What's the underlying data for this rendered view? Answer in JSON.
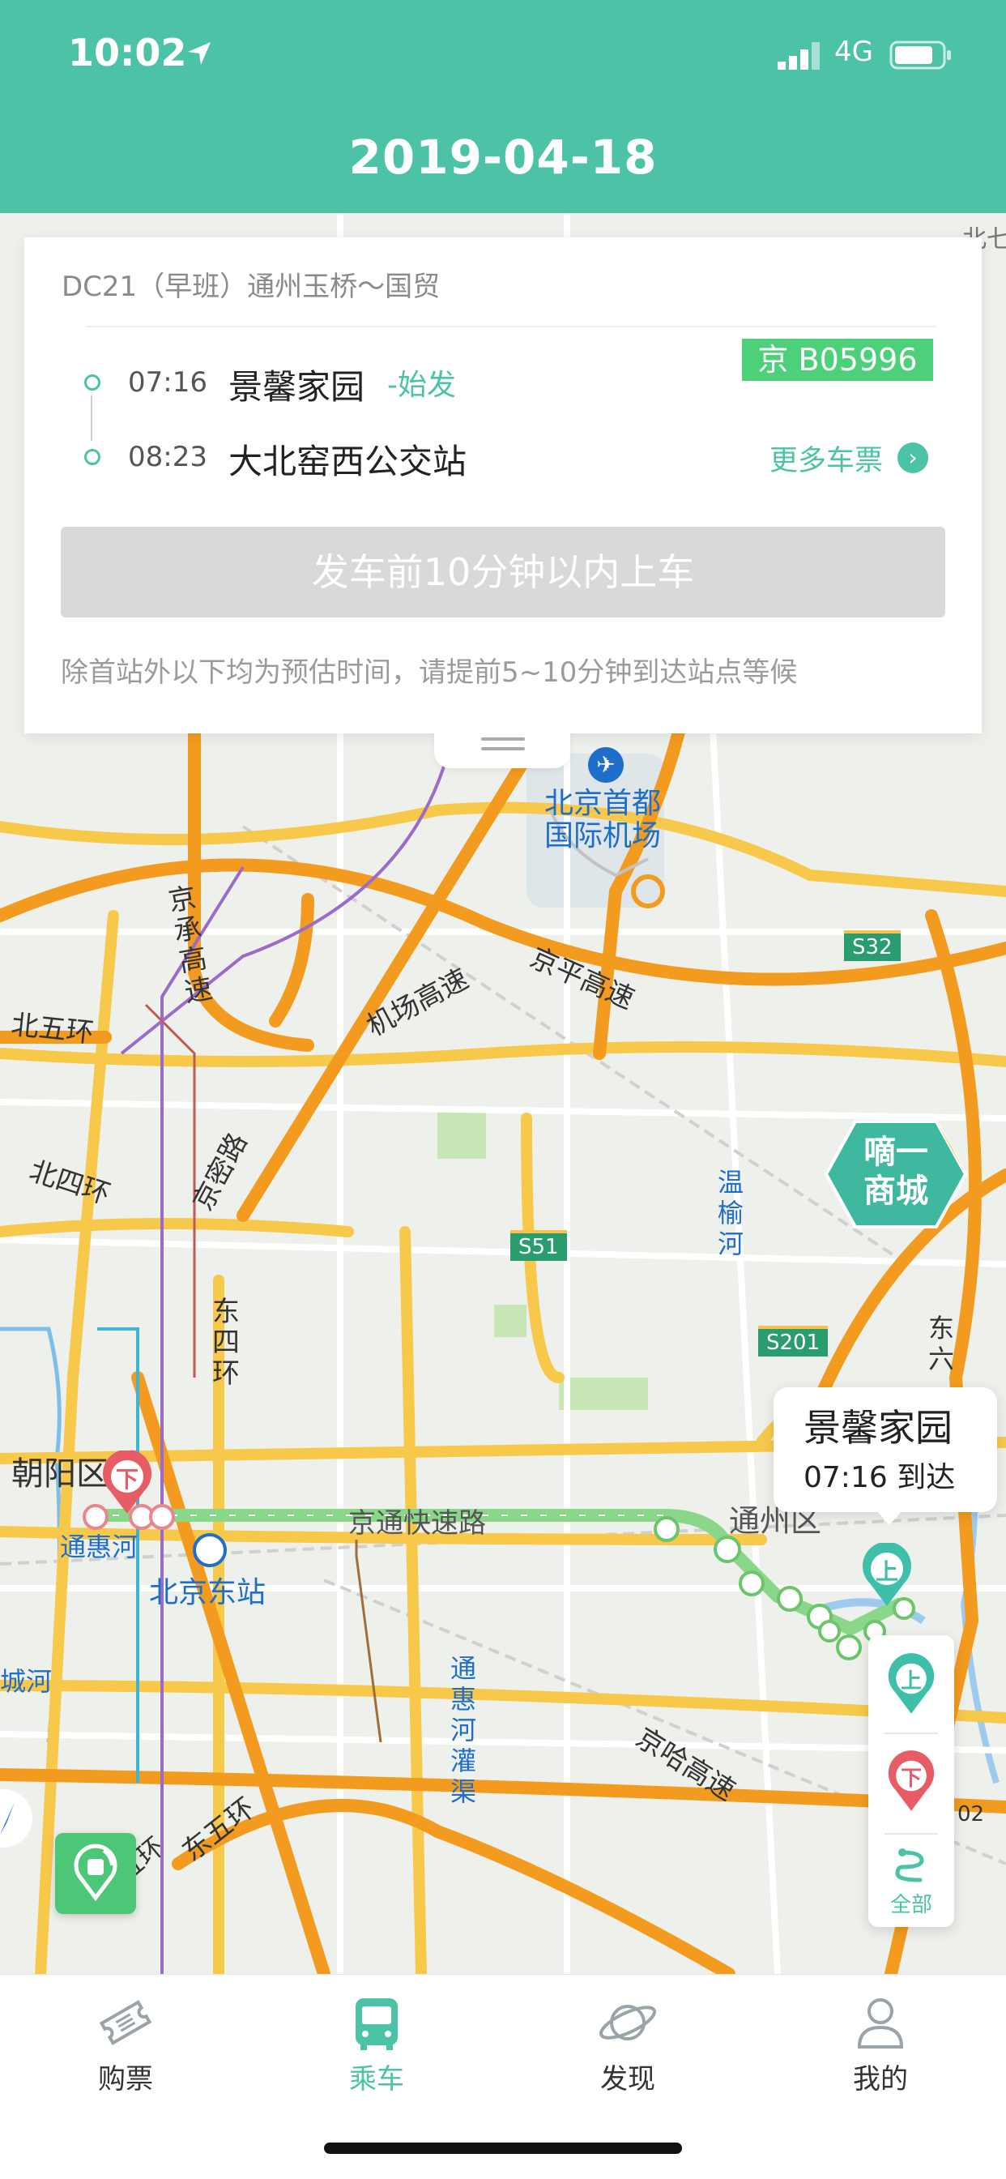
{
  "status_bar": {
    "time": "10:02",
    "network": "4G"
  },
  "header": {
    "title": "2019-04-18"
  },
  "ticket": {
    "line": "DC21（早班）通州玉桥～国贸",
    "plate": "京 B05996",
    "stops": [
      {
        "time": "07:16",
        "name": "景馨家园",
        "tag": "-始发"
      },
      {
        "time": "08:23",
        "name": "大北窑西公交站"
      }
    ],
    "more_tickets": "更多车票",
    "board_button": "发车前10分钟以内上车",
    "notice": "除首站外以下均为预估时间，请提前5~10分钟到达站点等候"
  },
  "map": {
    "labels": {
      "airport": "北京首都\n国际机场",
      "airport_expwy": "机场高速",
      "jingping": "京平高速",
      "jingcheng": "京承高速",
      "north5": "北五环",
      "north4": "北四环",
      "jingmi": "京密路",
      "east4": "东四环",
      "east5": "东五环",
      "chaoyang": "朝阳区",
      "tonghuihe": "通惠河",
      "beijing_east_station": "北京东站",
      "jingtong": "京通快速路",
      "tongzhou": "通州区",
      "wenyu": "温榆河",
      "tonghui_canal": "通惠河灌渠",
      "jingha": "京哈高速",
      "s32": "S32",
      "s51": "S51",
      "s201": "S201",
      "cheng_river": "城河",
      "north_edge": "北七",
      "east6": "东六",
      "east5b": "五环",
      "small_02": "02",
      "promo": "嘀一\n商城"
    },
    "callout": {
      "name": "景馨家园",
      "time": "07:16 到达"
    },
    "controls": {
      "board_marker": "上",
      "alight_marker": "下",
      "all_label": "全部"
    },
    "route_color": "#8bd78a",
    "accent": "#4cc3a6"
  },
  "tabs": [
    {
      "label": "购票",
      "icon": "ticket-icon",
      "active": false
    },
    {
      "label": "乘车",
      "icon": "bus-icon",
      "active": true
    },
    {
      "label": "发现",
      "icon": "planet-icon",
      "active": false
    },
    {
      "label": "我的",
      "icon": "person-icon",
      "active": false
    }
  ]
}
